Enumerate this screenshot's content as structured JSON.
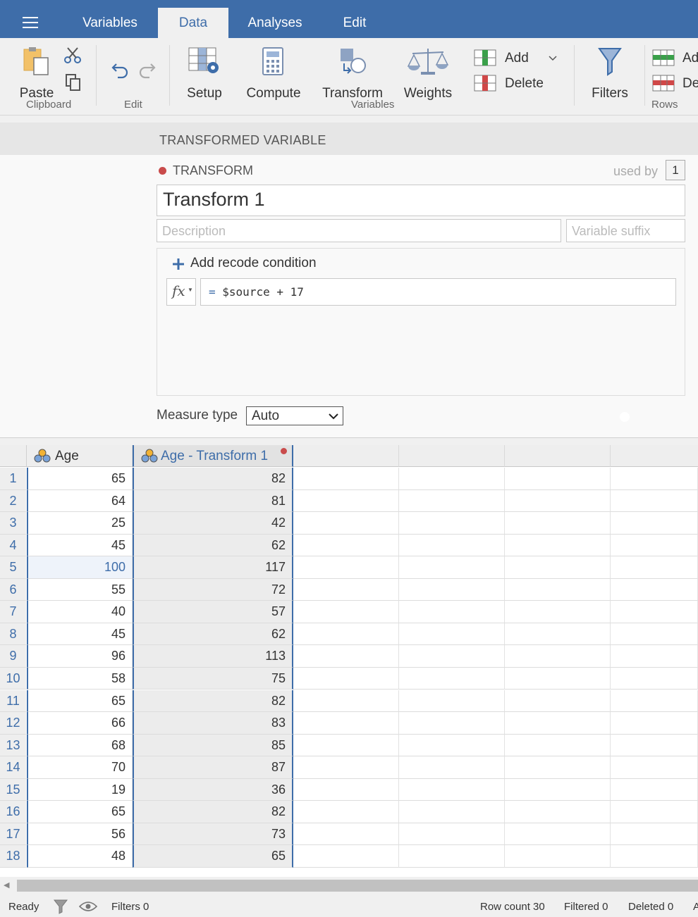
{
  "tabs": [
    "Variables",
    "Data",
    "Analyses",
    "Edit"
  ],
  "active_tab": "Data",
  "ribbon": {
    "clipboard": {
      "paste": "Paste",
      "group": "Clipboard"
    },
    "edit": {
      "group": "Edit"
    },
    "variables": {
      "setup": "Setup",
      "compute": "Compute",
      "transform": "Transform",
      "weights": "Weights",
      "add": "Add",
      "delete": "Delete",
      "group": "Variables"
    },
    "filters": "Filters",
    "rows": {
      "add": "Ad",
      "delete": "De",
      "group": "Rows"
    }
  },
  "section_title": "TRANSFORMED VARIABLE",
  "transform": {
    "type_label": "TRANSFORM",
    "used_by_label": "used by",
    "used_by_count": "1",
    "name": "Transform 1",
    "description_placeholder": "Description",
    "suffix_placeholder": "Variable suffix",
    "add_condition": "Add recode condition",
    "fx_label": "fx",
    "formula_eq": "=",
    "formula": "$source + 17",
    "measure_type_label": "Measure type",
    "measure_type_value": "Auto"
  },
  "grid": {
    "columns": [
      "Age",
      "Age - Transform 1"
    ],
    "rows": [
      [
        "1",
        "65",
        "82"
      ],
      [
        "2",
        "64",
        "81"
      ],
      [
        "3",
        "25",
        "42"
      ],
      [
        "4",
        "45",
        "62"
      ],
      [
        "5",
        "100",
        "117"
      ],
      [
        "6",
        "55",
        "72"
      ],
      [
        "7",
        "40",
        "57"
      ],
      [
        "8",
        "45",
        "62"
      ],
      [
        "9",
        "96",
        "113"
      ],
      [
        "10",
        "58",
        "75"
      ],
      [
        "11",
        "65",
        "82"
      ],
      [
        "12",
        "66",
        "83"
      ],
      [
        "13",
        "68",
        "85"
      ],
      [
        "14",
        "70",
        "87"
      ],
      [
        "15",
        "19",
        "36"
      ],
      [
        "16",
        "65",
        "82"
      ],
      [
        "17",
        "56",
        "73"
      ],
      [
        "18",
        "48",
        "65"
      ]
    ]
  },
  "status": {
    "ready": "Ready",
    "filters": "Filters 0",
    "row_count": "Row count 30",
    "filtered": "Filtered 0",
    "deleted": "Deleted 0",
    "trailing": "A"
  },
  "colors": {
    "accent": "#3e6da9",
    "transform_dot": "#c94b4b"
  }
}
